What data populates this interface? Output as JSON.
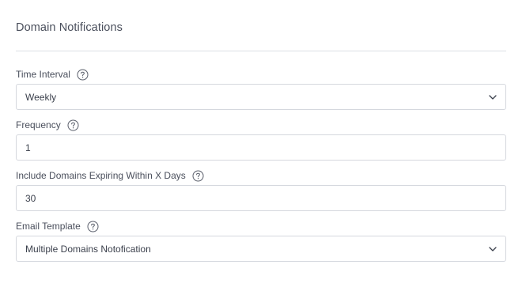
{
  "section": {
    "title": "Domain Notifications"
  },
  "fields": {
    "time_interval": {
      "label": "Time Interval",
      "value": "Weekly",
      "help_icon": "question-circle-icon"
    },
    "frequency": {
      "label": "Frequency",
      "value": "1",
      "help_icon": "question-circle-icon"
    },
    "expiring_days": {
      "label": "Include Domains Expiring Within X Days",
      "value": "30",
      "help_icon": "question-circle-icon"
    },
    "email_template": {
      "label": "Email Template",
      "value": "Multiple Domains Notofication",
      "help_icon": "question-circle-icon"
    }
  },
  "colors": {
    "text": "#3a3f4b",
    "label": "#4a4f5c",
    "border": "#d5d8de",
    "divider": "#dcdfe4"
  }
}
